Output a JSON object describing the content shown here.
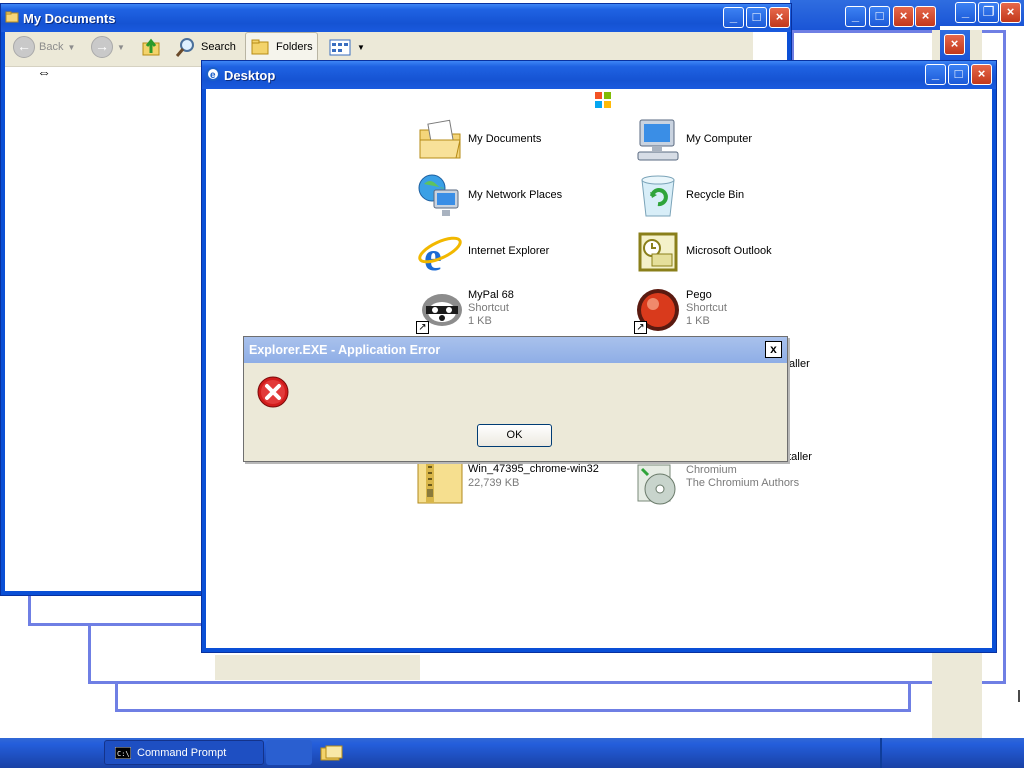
{
  "my_documents_window": {
    "title": "My Documents",
    "toolbar": {
      "back_label": "Back",
      "search_label": "Search",
      "folders_label": "Folders"
    }
  },
  "desktop_window": {
    "title": "Desktop",
    "items": [
      {
        "label": "My Documents",
        "icon": "my-documents-icon"
      },
      {
        "label": "My Computer",
        "icon": "my-computer-icon"
      },
      {
        "label": "My Network Places",
        "icon": "network-places-icon"
      },
      {
        "label": "Recycle Bin",
        "icon": "recycle-bin-icon"
      },
      {
        "label": "Internet Explorer",
        "icon": "internet-explorer-icon"
      },
      {
        "label": "Microsoft Outlook",
        "icon": "outlook-icon"
      },
      {
        "label": "MyPal 68",
        "sub1": "Shortcut",
        "sub2": "1 KB",
        "icon": "mypal-icon"
      },
      {
        "label": "Pego",
        "sub1": "Shortcut",
        "sub2": "1 KB",
        "icon": "pego-icon"
      },
      {
        "label": "Win_47395_chrome-win32",
        "sub1": "22,739 KB",
        "icon": "zip-folder-icon"
      },
      {
        "label": "Win_47395_mini_installer",
        "sub1": "Chromium",
        "sub2": "The Chromium Authors",
        "icon": "installer-icon"
      }
    ],
    "partial_label_behind_dialog": "aller"
  },
  "error_dialog": {
    "title": "Explorer.EXE - Application Error",
    "close_label": "x",
    "ok_label": "OK",
    "icon": "error-icon"
  },
  "taskbar": {
    "task_label": "Command Prompt"
  }
}
